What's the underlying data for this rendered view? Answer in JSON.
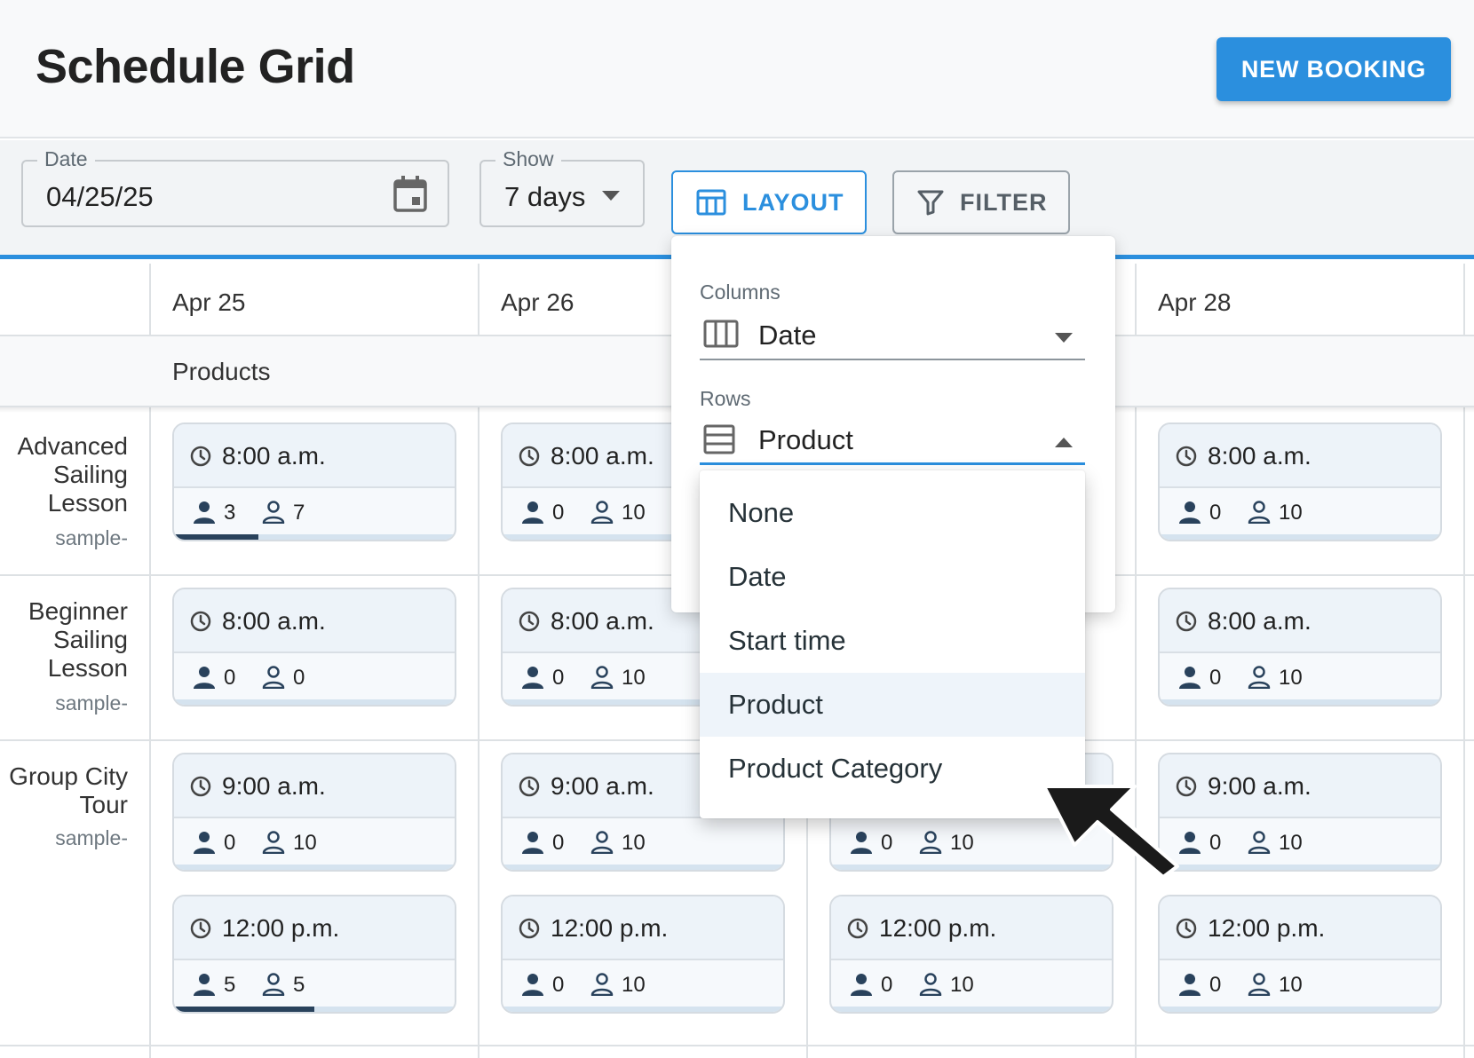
{
  "header": {
    "title": "Schedule Grid",
    "new_booking_label": "NEW BOOKING"
  },
  "toolbar": {
    "date": {
      "label": "Date",
      "value": "04/25/25"
    },
    "show": {
      "label": "Show",
      "value": "7 days"
    },
    "layout_label": "LAYOUT",
    "filter_label": "FILTER"
  },
  "grid": {
    "dates": [
      "Apr 25",
      "Apr 26",
      "Apr 28"
    ],
    "group_label": "Products",
    "rows": [
      {
        "name": "Advanced Sailing Lesson",
        "sub": "sample-"
      },
      {
        "name": "Beginner Sailing Lesson",
        "sub": "sample-"
      },
      {
        "name": "Group City Tour",
        "sub": "sample-"
      }
    ],
    "slots": [
      {
        "time": "8:00 a.m.",
        "booked": "3",
        "available": "7",
        "fill": 0.3
      },
      {
        "time": "8:00 a.m.",
        "booked": "0",
        "available": "10",
        "fill": 0
      },
      {
        "time": "8:00 a.m.",
        "booked": "0",
        "available": "10",
        "fill": 0
      },
      {
        "time": "8:00 a.m.",
        "booked": "0",
        "available": "0",
        "fill": 0
      },
      {
        "time": "8:00 a.m.",
        "booked": "0",
        "available": "10",
        "fill": 0
      },
      {
        "time": "8:00 a.m.",
        "booked": "0",
        "available": "10",
        "fill": 0
      },
      {
        "time": "9:00 a.m.",
        "booked": "0",
        "available": "10",
        "fill": 0
      },
      {
        "time": "9:00 a.m.",
        "booked": "0",
        "available": "10",
        "fill": 0
      },
      {
        "time": "9:00 a.m.",
        "booked": "0",
        "available": "10",
        "fill": 0
      },
      {
        "time": "12:00 p.m.",
        "booked": "5",
        "available": "5",
        "fill": 0.5
      },
      {
        "time": "12:00 p.m.",
        "booked": "0",
        "available": "10",
        "fill": 0
      },
      {
        "time": "12:00 p.m.",
        "booked": "0",
        "available": "10",
        "fill": 0
      },
      {
        "time": "12:00 p.m.",
        "booked": "0",
        "available": "10",
        "fill": 0
      },
      {
        "booked": "0",
        "available": "10",
        "fill": 0
      }
    ]
  },
  "layout_popover": {
    "columns_label": "Columns",
    "columns_value": "Date",
    "rows_label": "Rows",
    "rows_value": "Product",
    "options": [
      "None",
      "Date",
      "Start time",
      "Product",
      "Product Category"
    ],
    "selected_option": "Product"
  },
  "colors": {
    "accent": "#2b8fde",
    "capacity_fill": "#29425c"
  },
  "icons": {
    "date_field": "calendar-icon",
    "show_field": "caret-down-icon",
    "layout": "table-columns-icon",
    "filter": "funnel-icon",
    "slot_time": "clock-icon",
    "booked": "person-filled-icon",
    "available": "person-outline-icon",
    "columns": "columns-icon",
    "rows": "rows-icon",
    "pointer": "arrow-cursor-icon"
  }
}
